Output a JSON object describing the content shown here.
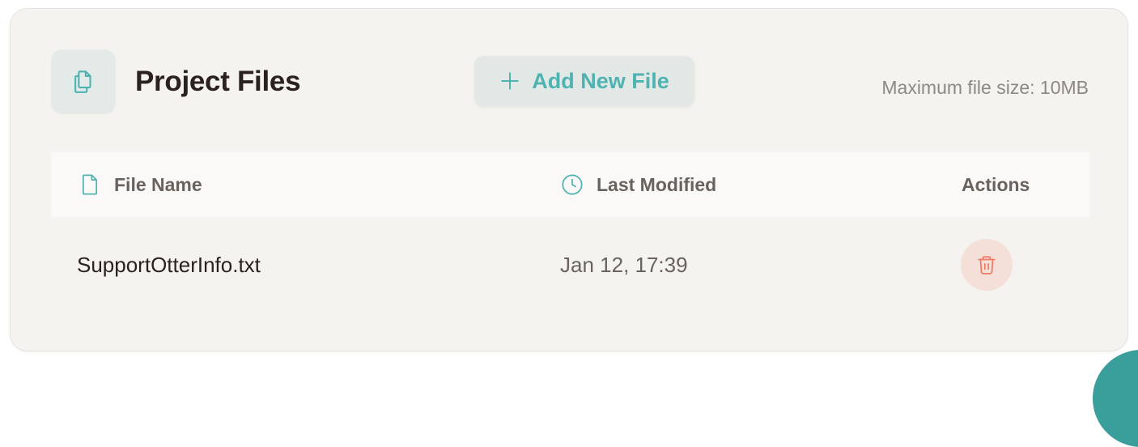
{
  "panel": {
    "title": "Project Files",
    "icon": "documents-icon",
    "add_button_label": "Add New File",
    "max_file_size_text": "Maximum file size: 10MB"
  },
  "table": {
    "columns": {
      "file_name": "File Name",
      "last_modified": "Last Modified",
      "actions": "Actions"
    },
    "rows": [
      {
        "file_name": "SupportOtterInfo.txt",
        "last_modified": "Jan 12, 17:39",
        "action_icon": "trash-icon"
      }
    ]
  },
  "colors": {
    "accent": "#4fb3b1",
    "danger": "#ef7a63",
    "danger_bg": "#f5dfd9",
    "card_bg": "#f5f3ef",
    "text_primary": "#2b211e",
    "text_secondary": "#6a625d"
  }
}
